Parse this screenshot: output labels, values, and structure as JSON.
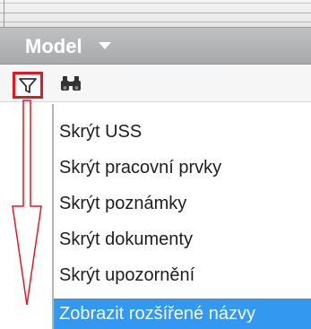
{
  "header": {
    "title": "Model"
  },
  "toolbar": {
    "filter_icon": "filter-icon",
    "search_icon": "binoculars-icon",
    "highlight_color": "#e01a22"
  },
  "menu": {
    "items": [
      {
        "label": "Skrýt USS",
        "selected": false
      },
      {
        "label": "Skrýt pracovní prvky",
        "selected": false
      },
      {
        "label": "Skrýt poznámky",
        "selected": false
      },
      {
        "label": "Skrýt dokumenty",
        "selected": false
      },
      {
        "label": "Skrýt upozornění",
        "selected": false
      },
      {
        "label": "Zobrazit rozšířené názvy",
        "selected": true
      }
    ],
    "selected_color": "#3399f0"
  }
}
